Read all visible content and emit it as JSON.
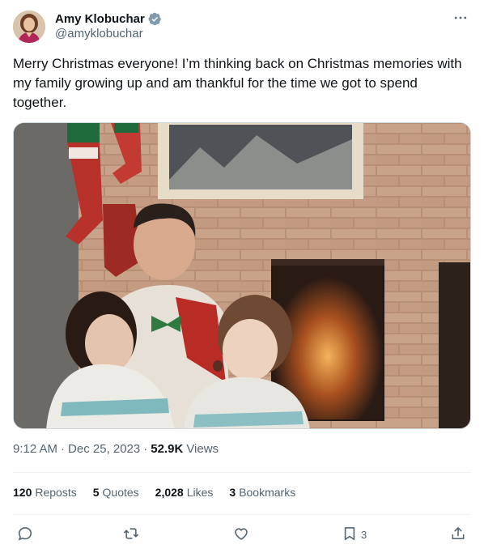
{
  "author": {
    "name": "Amy Klobuchar",
    "handle": "@amyklobuchar"
  },
  "tweet": {
    "text": "Merry Christmas everyone! I’m thinking back on Christmas memories with my family growing up and am thankful for the time we got to spend together.",
    "time": "9:12 AM",
    "date": "Dec 25, 2023",
    "views_count": "52.9K",
    "views_label": "Views"
  },
  "stats": {
    "reposts_count": "120",
    "reposts_label": "Reposts",
    "quotes_count": "5",
    "quotes_label": "Quotes",
    "likes_count": "2,028",
    "likes_label": "Likes",
    "bookmarks_count": "3",
    "bookmarks_label": "Bookmarks"
  },
  "actions": {
    "bookmark_count": "3"
  },
  "icons": {
    "verified": "verified-badge-icon",
    "more": "more-dots-icon",
    "reply": "reply-icon",
    "repost": "repost-icon",
    "like": "like-icon",
    "bookmark": "bookmark-icon",
    "share": "share-icon"
  },
  "colors": {
    "text_primary": "#0f1419",
    "text_secondary": "#536471",
    "verified": "#829aab",
    "divider": "#eff3f4"
  }
}
